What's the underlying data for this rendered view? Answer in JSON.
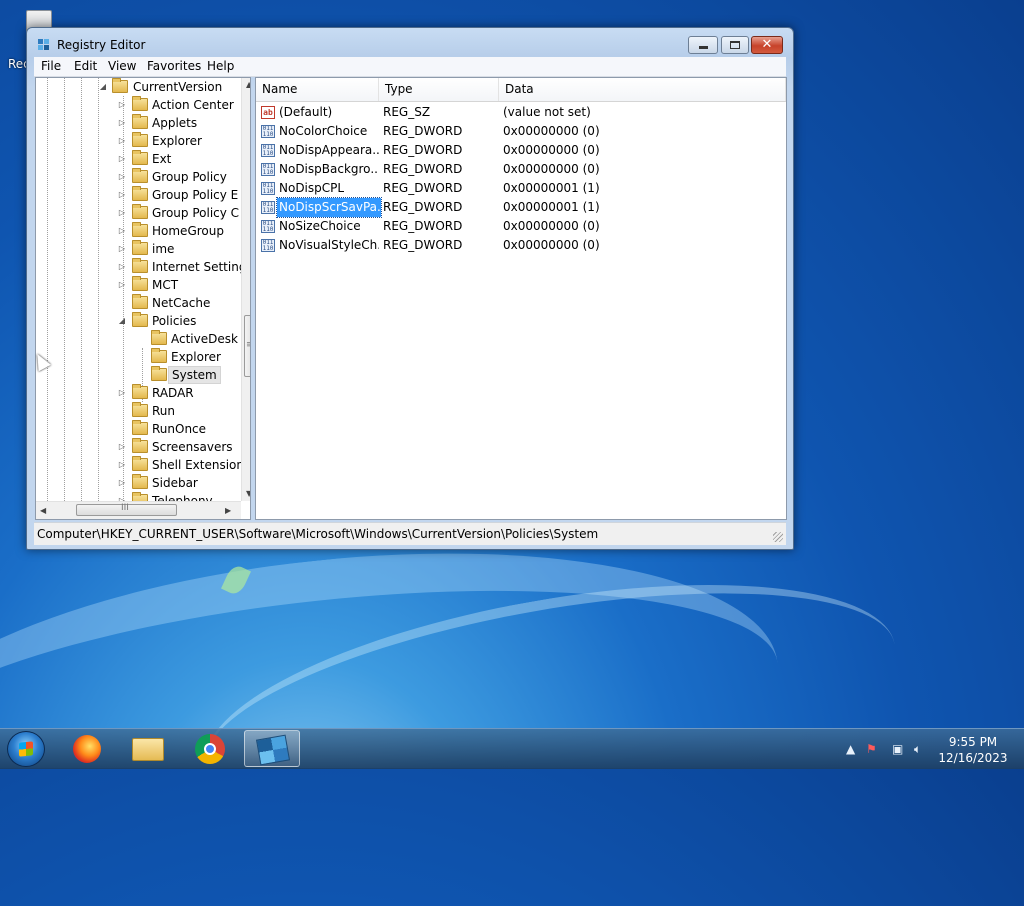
{
  "desktop": {
    "recycle_label": "Rec"
  },
  "window": {
    "title": "Registry Editor",
    "controls": {
      "minimize": "",
      "maximize": "",
      "close": "✕"
    }
  },
  "menu": [
    "File",
    "Edit",
    "View",
    "Favorites",
    "Help"
  ],
  "tree": {
    "parent": "CurrentVersion",
    "items": [
      {
        "label": "Action Center",
        "expandable": true
      },
      {
        "label": "Applets",
        "expandable": true
      },
      {
        "label": "Explorer",
        "expandable": true
      },
      {
        "label": "Ext",
        "expandable": true
      },
      {
        "label": "Group Policy",
        "expandable": true
      },
      {
        "label": "Group Policy E",
        "expandable": true
      },
      {
        "label": "Group Policy C",
        "expandable": true
      },
      {
        "label": "HomeGroup",
        "expandable": true
      },
      {
        "label": "ime",
        "expandable": true
      },
      {
        "label": "Internet Setting",
        "expandable": true
      },
      {
        "label": "MCT",
        "expandable": true
      },
      {
        "label": "NetCache",
        "expandable": false
      },
      {
        "label": "Policies",
        "expandable": true,
        "expanded": true
      },
      {
        "label": "ActiveDesk",
        "child": true
      },
      {
        "label": "Explorer",
        "child": true
      },
      {
        "label": "System",
        "child": true,
        "selected": true
      },
      {
        "label": "RADAR",
        "expandable": true
      },
      {
        "label": "Run",
        "expandable": false
      },
      {
        "label": "RunOnce",
        "expandable": false
      },
      {
        "label": "Screensavers",
        "expandable": true
      },
      {
        "label": "Shell Extension",
        "expandable": true
      },
      {
        "label": "Sidebar",
        "expandable": true
      },
      {
        "label": "Telephony",
        "expandable": true
      }
    ],
    "hscroll_thumb_glyph": "III"
  },
  "list": {
    "columns": [
      "Name",
      "Type",
      "Data"
    ],
    "rows": [
      {
        "name": "(Default)",
        "type": "REG_SZ",
        "data": "(value not set)",
        "icon": "string-value-icon"
      },
      {
        "name": "NoColorChoice",
        "type": "REG_DWORD",
        "data": "0x00000000 (0)",
        "icon": "dword-value-icon"
      },
      {
        "name": "NoDispAppeara...",
        "type": "REG_DWORD",
        "data": "0x00000000 (0)",
        "icon": "dword-value-icon"
      },
      {
        "name": "NoDispBackgro...",
        "type": "REG_DWORD",
        "data": "0x00000000 (0)",
        "icon": "dword-value-icon"
      },
      {
        "name": "NoDispCPL",
        "type": "REG_DWORD",
        "data": "0x00000001 (1)",
        "icon": "dword-value-icon"
      },
      {
        "name": "NoDispScrSavPa...",
        "type": "REG_DWORD",
        "data": "0x00000001 (1)",
        "icon": "dword-value-icon",
        "selected": true
      },
      {
        "name": "NoSizeChoice",
        "type": "REG_DWORD",
        "data": "0x00000000 (0)",
        "icon": "dword-value-icon"
      },
      {
        "name": "NoVisualStyleCh...",
        "type": "REG_DWORD",
        "data": "0x00000000 (0)",
        "icon": "dword-value-icon"
      }
    ]
  },
  "status": {
    "path": "Computer\\HKEY_CURRENT_USER\\Software\\Microsoft\\Windows\\CurrentVersion\\Policies\\System"
  },
  "taskbar": {
    "apps": [
      "firefox-icon",
      "file-explorer-icon",
      "chrome-icon",
      "registry-editor-icon"
    ],
    "time": "9:55 PM",
    "date": "12/16/2023"
  },
  "colors": {
    "selection": "#3399ff",
    "taskbar": "#1d3f64",
    "desktop": "#1a6ec8"
  }
}
